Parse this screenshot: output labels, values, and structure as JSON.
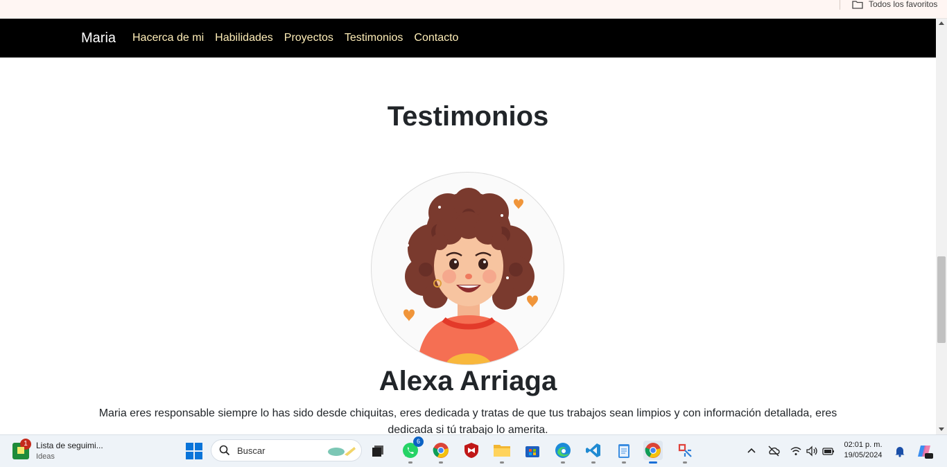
{
  "browser": {
    "bookmarks_folder_label": "Todos los favoritos"
  },
  "navbar": {
    "brand": "Maria",
    "links": [
      "Hacerca de mi",
      "Habilidades",
      "Proyectos",
      "Testimonios",
      "Contacto"
    ]
  },
  "section": {
    "title": "Testimonios"
  },
  "testimonial": {
    "name": "Alexa Arriaga",
    "text": "Maria eres responsable siempre lo has sido desde chiquitas, eres dedicada y tratas de que tus trabajos sean limpios y con información detallada, eres dedicada si tú trabajo lo amerita."
  },
  "taskbar": {
    "news_title": "Lista de seguimi...",
    "news_subtitle": "Ideas",
    "news_badge": "1",
    "search_placeholder": "Buscar",
    "whatsapp_badge": "6",
    "time": "02:01 p. m.",
    "date": "19/05/2024",
    "apps": [
      "task-view",
      "whatsapp",
      "chrome",
      "mcafee",
      "file-explorer",
      "microsoft-store",
      "edge",
      "vscode",
      "notepad",
      "chrome-active",
      "snipping-tool"
    ]
  },
  "colors": {
    "navbar_bg": "#000000",
    "nav_link": "#ffeeb8",
    "brand": "#ffffff",
    "heading": "#212529"
  }
}
